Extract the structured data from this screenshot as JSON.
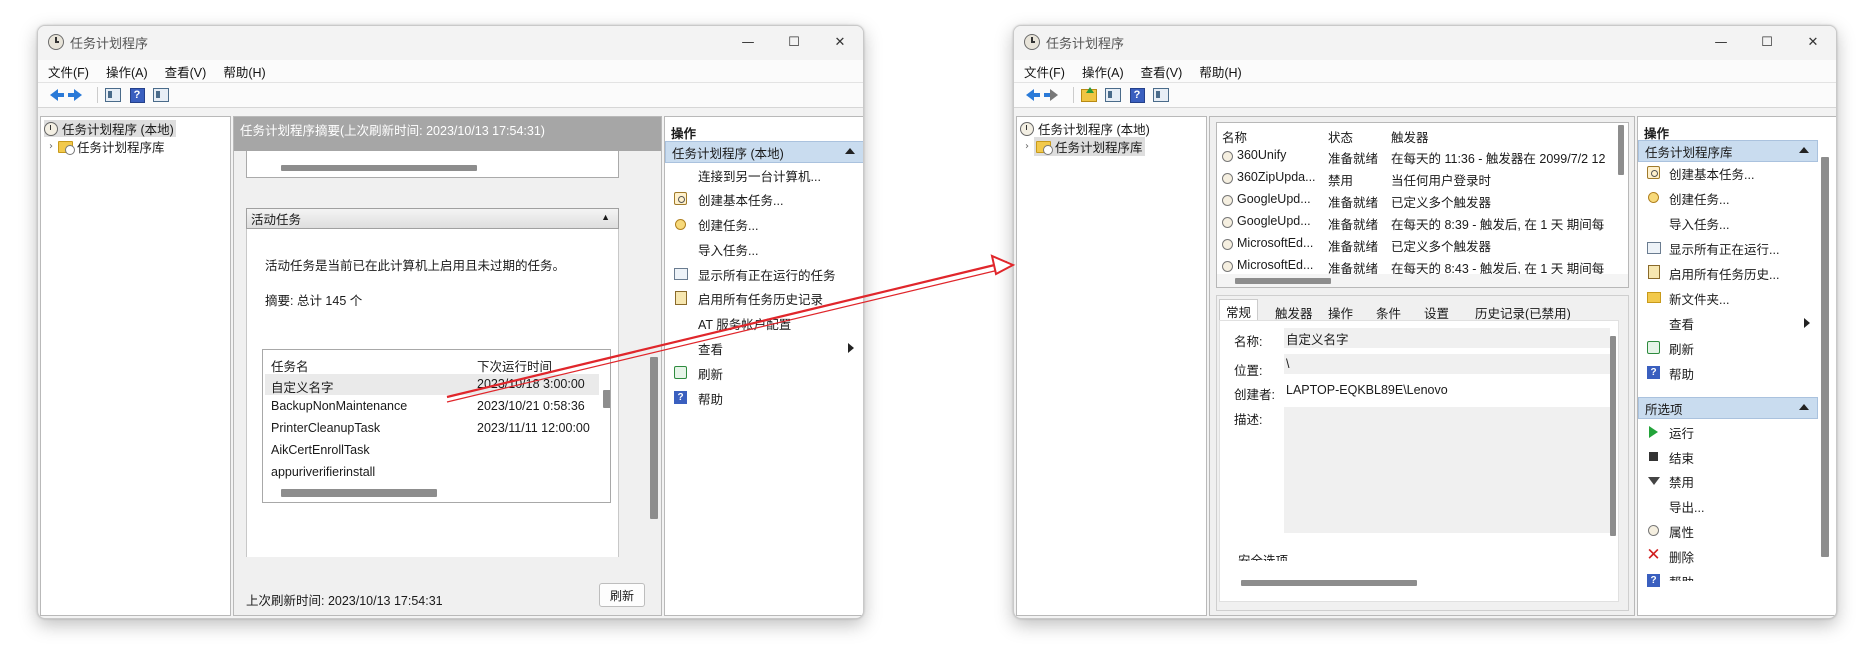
{
  "windows": {
    "left": {
      "title": "任务计划程序",
      "menu": [
        "文件(F)",
        "操作(A)",
        "查看(V)",
        "帮助(H)"
      ],
      "tree": {
        "root": "任务计划程序 (本地)",
        "library": "任务计划程序库"
      },
      "summary_header": "任务计划程序摘要(上次刷新时间: 2023/10/13 17:54:31)",
      "active_section": {
        "title": "活动任务",
        "description": "活动任务是当前已在此计算机上启用且未过期的任务。",
        "summary": "摘要: 总计 145 个",
        "columns": [
          "任务名",
          "下次运行时间"
        ],
        "rows": [
          [
            "自定义名字",
            "2023/10/18 3:00:00"
          ],
          [
            "BackupNonMaintenance",
            "2023/10/21 0:58:36"
          ],
          [
            "PrinterCleanupTask",
            "2023/11/11 12:00:00"
          ],
          [
            "AikCertEnrollTask",
            ""
          ],
          [
            "appuriverifierinstall",
            ""
          ]
        ]
      },
      "footer": {
        "last_refresh": "上次刷新时间: 2023/10/13 17:54:31",
        "refresh_button": "刷新"
      },
      "actions": {
        "title": "操作",
        "group": "任务计划程序 (本地)",
        "items": [
          "连接到另一台计算机...",
          "创建基本任务...",
          "创建任务...",
          "导入任务...",
          "显示所有正在运行的任务",
          "启用所有任务历史记录",
          "AT 服务帐户配置",
          "查看",
          "刷新",
          "帮助"
        ]
      }
    },
    "right": {
      "title": "任务计划程序",
      "menu": [
        "文件(F)",
        "操作(A)",
        "查看(V)",
        "帮助(H)"
      ],
      "tree": {
        "root": "任务计划程序 (本地)",
        "library": "任务计划程序库"
      },
      "task_list": {
        "columns": [
          "名称",
          "状态",
          "触发器"
        ],
        "rows": [
          [
            "360Unify",
            "准备就绪",
            "在每天的 11:36 - 触发器在 2099/7/2 12"
          ],
          [
            "360ZipUpda...",
            "禁用",
            "当任何用户登录时"
          ],
          [
            "GoogleUpd...",
            "准备就绪",
            "已定义多个触发器"
          ],
          [
            "GoogleUpd...",
            "准备就绪",
            "在每天的 8:39 - 触发后, 在 1 天 期间每"
          ],
          [
            "MicrosoftEd...",
            "准备就绪",
            "已定义多个触发器"
          ],
          [
            "MicrosoftEd...",
            "准备就绪",
            "在每天的 8:43 - 触发后, 在 1 天 期间每"
          ]
        ]
      },
      "tabs": [
        "常规",
        "触发器",
        "操作",
        "条件",
        "设置",
        "历史记录(已禁用)"
      ],
      "general": {
        "name_label": "名称:",
        "name_value": "自定义名字",
        "location_label": "位置:",
        "location_value": "\\",
        "author_label": "创建者:",
        "author_value": "LAPTOP-EQKBL89E\\Lenovo",
        "desc_label": "描述:",
        "security_label": "安全选项"
      },
      "actions": {
        "title": "操作",
        "group1": "任务计划程序库",
        "items1": [
          "创建基本任务...",
          "创建任务...",
          "导入任务...",
          "显示所有正在运行...",
          "启用所有任务历史...",
          "新文件夹...",
          "查看",
          "刷新",
          "帮助"
        ],
        "group2": "所选项",
        "items2": [
          "运行",
          "结束",
          "禁用",
          "导出...",
          "属性",
          "删除",
          "帮助"
        ]
      }
    }
  },
  "colors": {
    "accent_arrow": "#e0262b",
    "action_header": "#c9dcef",
    "selected_row": "#eaeaea"
  }
}
